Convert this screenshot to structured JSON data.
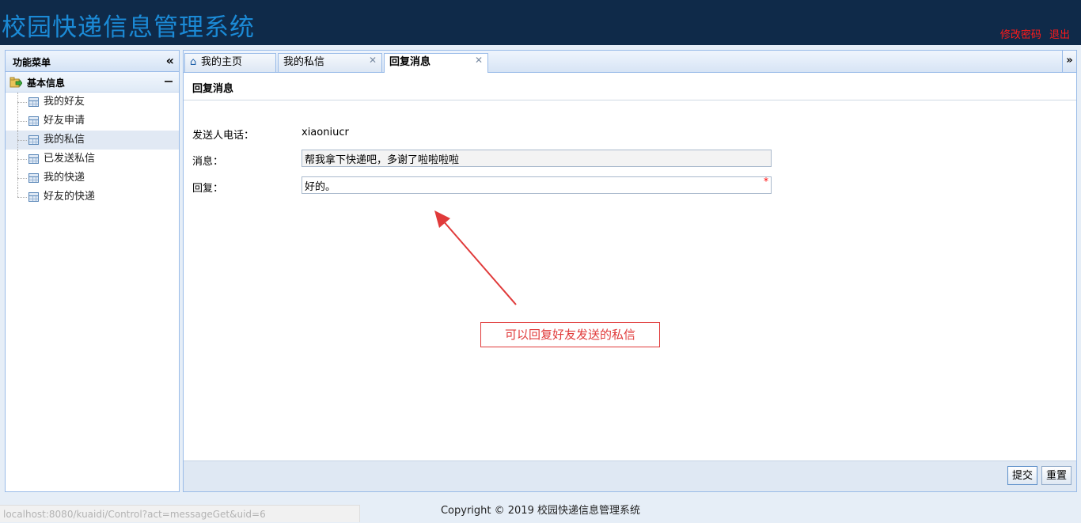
{
  "header": {
    "title": "校园快递信息管理系统",
    "change_password": "修改密码",
    "logout": "退出"
  },
  "menu": {
    "title": "功能菜单",
    "collapse_icon": "double-chevron-left-icon",
    "group_title": "基本信息",
    "items": [
      {
        "label": "我的好友"
      },
      {
        "label": "好友申请"
      },
      {
        "label": "我的私信",
        "active": true
      },
      {
        "label": "已发送私信"
      },
      {
        "label": "我的快递"
      },
      {
        "label": "好友的快递"
      }
    ]
  },
  "tabs": [
    {
      "label": "我的主页",
      "icon": "home-icon"
    },
    {
      "label": "我的私信",
      "closable": true
    },
    {
      "label": "回复消息",
      "closable": true,
      "active": true
    }
  ],
  "panel": {
    "title": "回复消息"
  },
  "form": {
    "sender_phone_label": "发送人电话：",
    "sender_phone_value": "xiaoniucr",
    "message_label": "消息：",
    "message_value": "帮我拿下快递吧，多谢了啦啦啦啦",
    "reply_label": "回复：",
    "reply_value": "好的。",
    "required_mark": "*"
  },
  "annotation": {
    "text": "可以回复好友发送的私信",
    "color": "#e03a3a"
  },
  "buttons": {
    "submit": "提交",
    "reset": "重置"
  },
  "footer": {
    "copyright": "Copyright © 2019 校园快递信息管理系统"
  },
  "status_bar": {
    "url": "localhost:8080/kuaidi/Control?act=messageGet&uid=6"
  },
  "colors": {
    "header_bg": "#0f2a49",
    "title_color": "#1b8ad6",
    "link_red": "#ff1a1a"
  }
}
